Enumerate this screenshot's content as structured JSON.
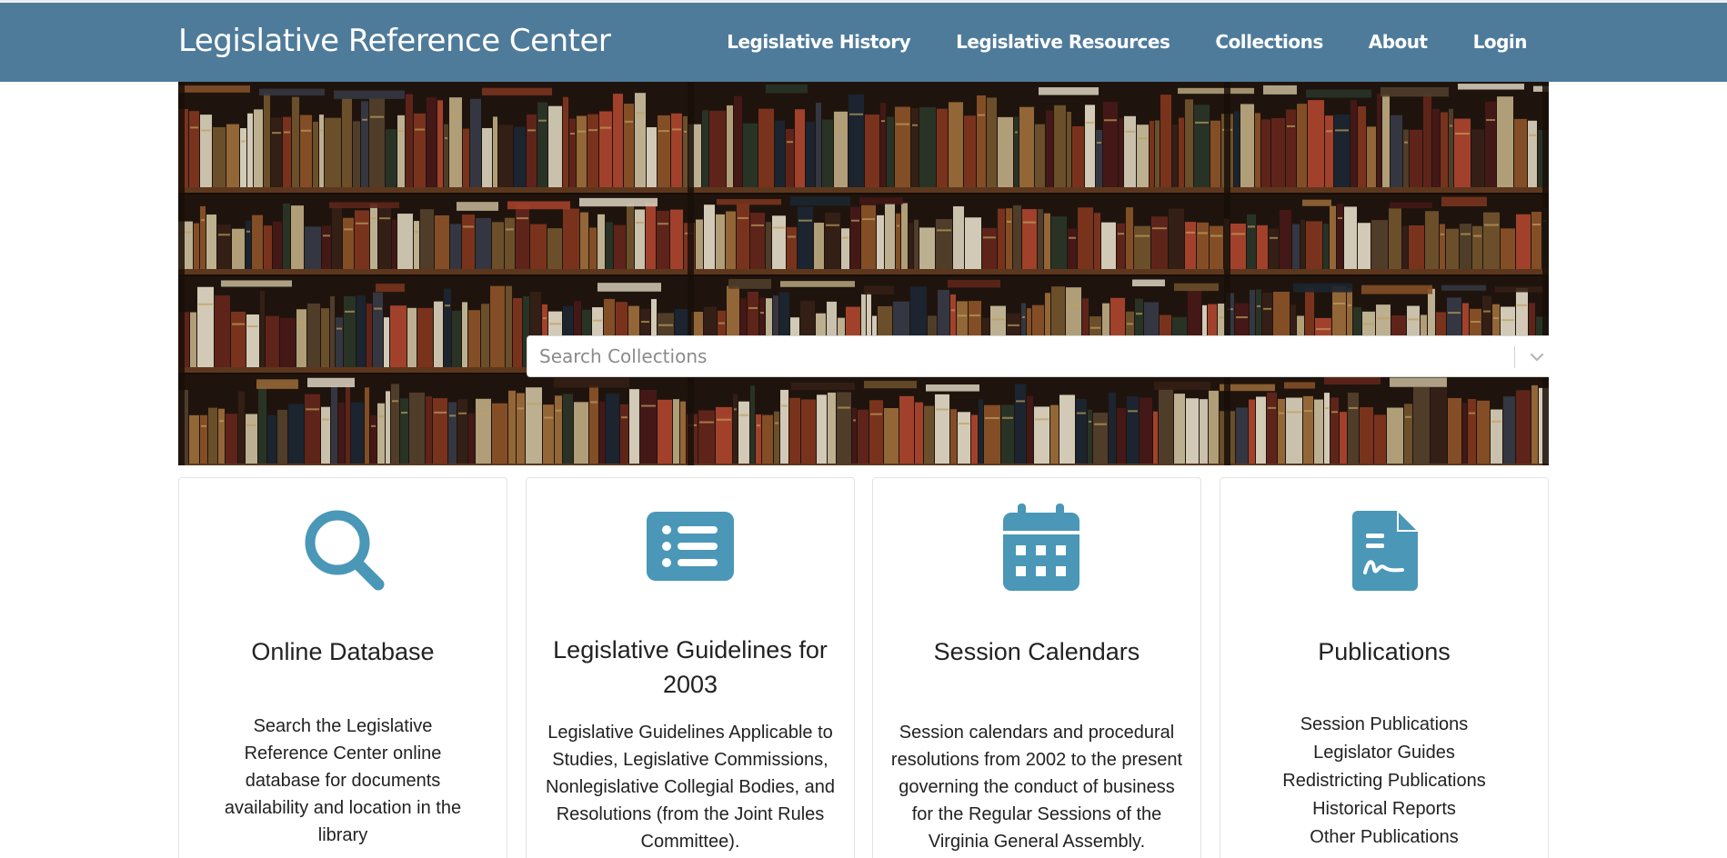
{
  "header": {
    "brand": "Legislative Reference Center",
    "nav": [
      {
        "label": "Legislative History"
      },
      {
        "label": "Legislative Resources"
      },
      {
        "label": "Collections"
      },
      {
        "label": "About"
      },
      {
        "label": "Login"
      }
    ]
  },
  "search": {
    "placeholder": "Search Collections"
  },
  "cards": [
    {
      "icon": "search-icon",
      "title": "Online Database",
      "text": "Search the Legislative Reference Center online database for documents availability and location in the library"
    },
    {
      "icon": "list-icon",
      "title": "Legislative Guidelines for 2003",
      "text": "Legislative Guidelines Applicable to Studies, Legislative Commissions, Nonlegislative Collegial Bodies, and Resolutions (from the Joint Rules Committee)."
    },
    {
      "icon": "calendar-icon",
      "title": "Session Calendars",
      "text": "Session calendars and procedural resolutions from 2002 to the present governing the conduct of business for the Regular Sessions of the Virginia General Assembly."
    },
    {
      "icon": "signed-document-icon",
      "title": "Publications",
      "links": [
        "Session Publications",
        "Legislator Guides",
        "Redistricting Publications",
        "Historical Reports",
        "Other Publications"
      ]
    }
  ],
  "colors": {
    "navbar": "#4f7b9a",
    "icon": "#4a97b8"
  }
}
